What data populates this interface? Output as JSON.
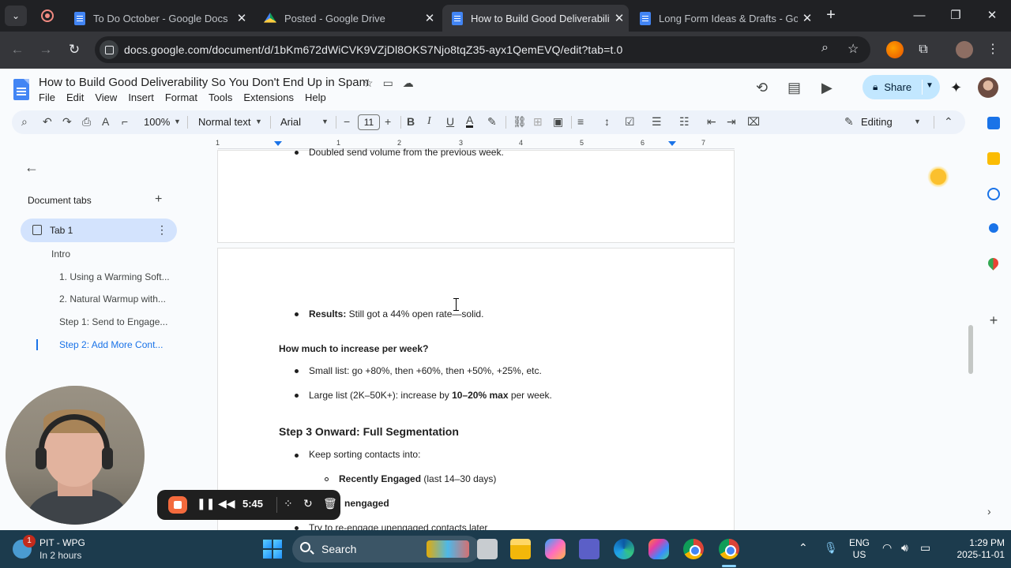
{
  "browser": {
    "tabs": [
      {
        "title": "To Do October - Google Docs",
        "icon": "docs-icon",
        "active": false
      },
      {
        "title": "Posted - Google Drive",
        "icon": "drive-icon",
        "active": false
      },
      {
        "title": "How to Build Good Deliverabilit",
        "icon": "docs-icon",
        "active": true
      },
      {
        "title": "Long Form Ideas & Drafts - Goo",
        "icon": "docs-icon",
        "active": false
      }
    ],
    "close_glyph": "✕",
    "new_tab_glyph": "+",
    "url": "docs.google.com/document/d/1bKm672dWiCVK9VZjDl8OKS7Njo8tqZ35-ayx1QemEVQ/edit?tab=t.0"
  },
  "docs": {
    "title": "How to Build Good Deliverability So You Don't End Up in Spam",
    "menu": [
      "File",
      "Edit",
      "View",
      "Insert",
      "Format",
      "Tools",
      "Extensions",
      "Help"
    ],
    "share_label": "Share",
    "toolbar": {
      "zoom": "100%",
      "style": "Normal text",
      "font": "Arial",
      "font_size": "11",
      "mode": "Editing"
    },
    "ruler_ticks": [
      "1",
      "1",
      "2",
      "3",
      "4",
      "5",
      "6",
      "7"
    ]
  },
  "sidebar": {
    "heading": "Document tabs",
    "tab_label": "Tab 1",
    "outline": [
      {
        "label": "Intro",
        "active": false
      },
      {
        "label": "1. Using a Warming Soft...",
        "active": false
      },
      {
        "label": "2. Natural Warmup with...",
        "active": false
      },
      {
        "label": "Step 1: Send to Engage...",
        "active": false
      },
      {
        "label": "Step 2: Add More Cont...",
        "active": true
      }
    ]
  },
  "content": {
    "page1_bullet": "Doubled send volume from the previous week.",
    "results_bold": "Results:",
    "results_text": " Still got a 44% open rate—solid.",
    "heading_increase": "How much to increase per week?",
    "small_list": "Small list: go +80%, then +60%, then +50%, +25%, etc.",
    "large_list_pre": "Large list (2K–50K+): increase by ",
    "large_list_bold": "10–20% max",
    "large_list_post": " per week.",
    "heading_step3": "Step 3 Onward: Full Segmentation",
    "keep_sorting": "Keep sorting contacts into:",
    "recently_bold": "Recently Engaged",
    "recently_text": " (last 14–30 days)",
    "unengaged_bold": "nengaged",
    "reengage": "Try to re-engage unengaged contacts later"
  },
  "recorder": {
    "time": "5:45"
  },
  "taskbar": {
    "weather_badge": "1",
    "weather_title": "PIT - WPG",
    "weather_sub": "In 2 hours",
    "search_label": "Search",
    "lang_top": "ENG",
    "lang_bottom": "US",
    "time": "1:29 PM",
    "date": "2025-11-01"
  }
}
